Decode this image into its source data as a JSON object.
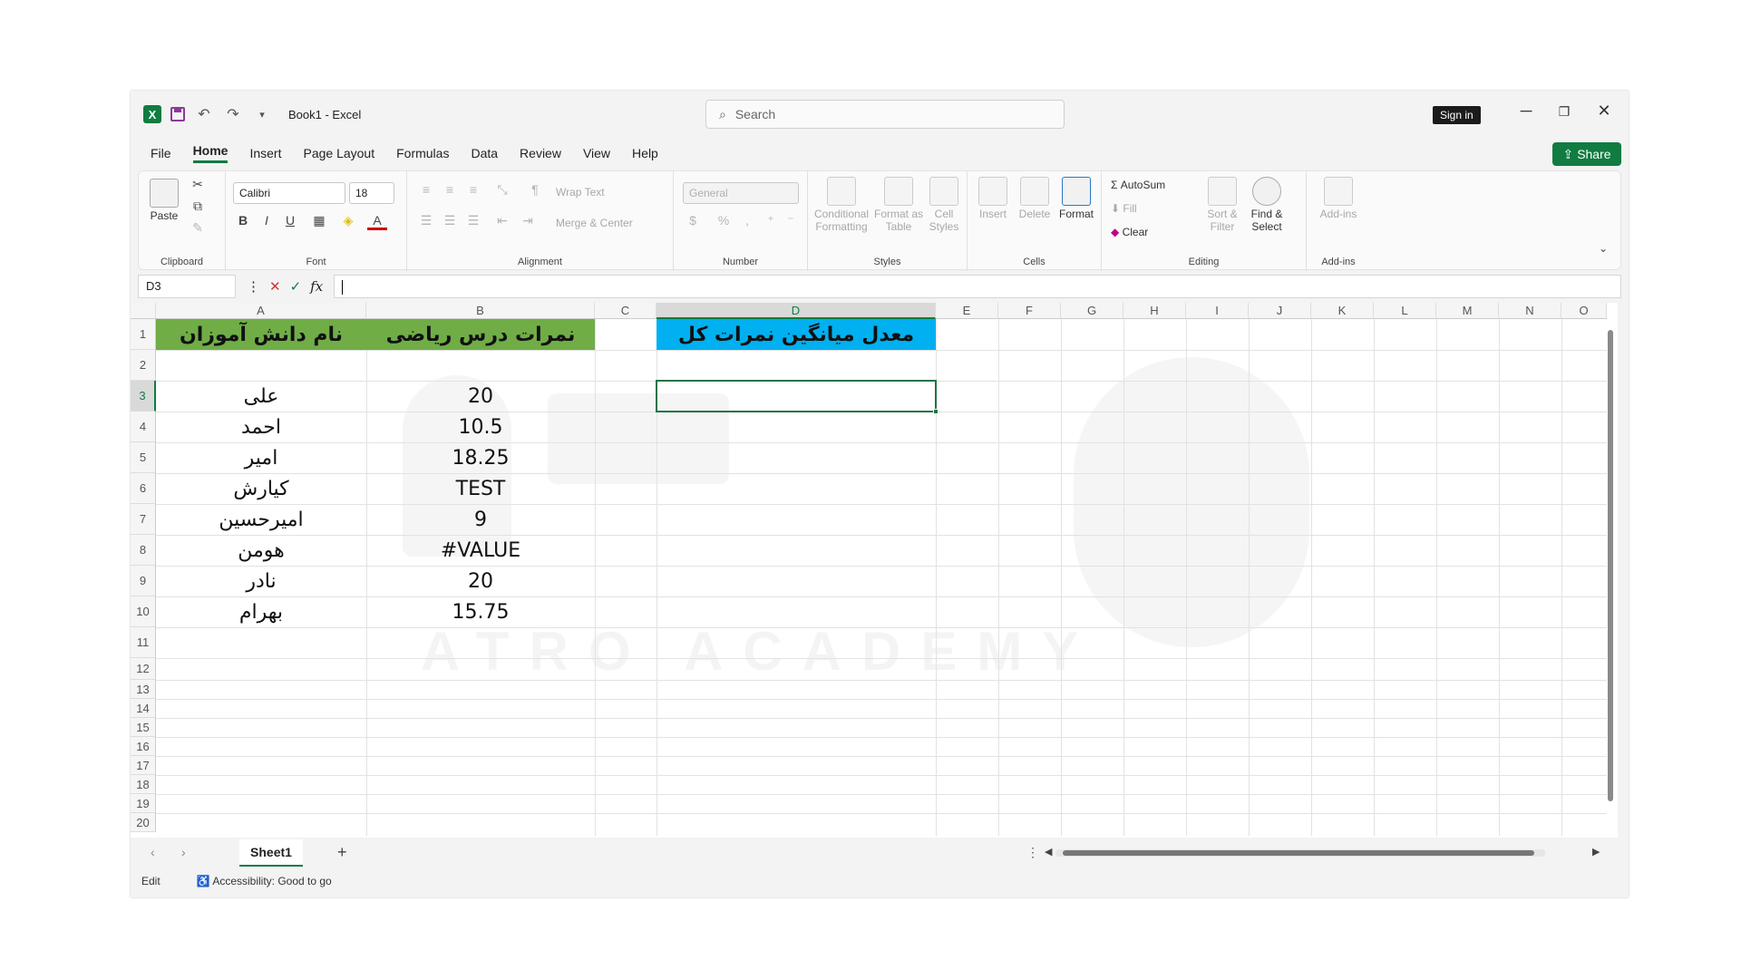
{
  "title_bar": {
    "doc_title": "Book1  -  Excel",
    "search_placeholder": "Search",
    "sign_in": "Sign in",
    "icons": [
      "excel-logo-icon",
      "save-icon",
      "undo-icon",
      "redo-icon",
      "customize-icon"
    ]
  },
  "menu": {
    "tabs": [
      "File",
      "Home",
      "Insert",
      "Page Layout",
      "Formulas",
      "Data",
      "Review",
      "View",
      "Help"
    ],
    "active": "Home",
    "share_label": "Share"
  },
  "ribbon": {
    "clipboard": {
      "label": "Clipboard",
      "paste": "Paste"
    },
    "font": {
      "label": "Font",
      "font_name": "Calibri",
      "font_size": "18"
    },
    "alignment": {
      "label": "Alignment",
      "wrap_text": "Wrap Text",
      "merge_center": "Merge & Center"
    },
    "number": {
      "label": "Number",
      "format": "General"
    },
    "styles": {
      "label": "Styles",
      "conditional": "Conditional",
      "conditional2": "Formatting",
      "format_as": "Format as",
      "format_as2": "Table",
      "cell": "Cell",
      "cell2": "Styles"
    },
    "cells": {
      "label": "Cells",
      "insert": "Insert",
      "delete": "Delete",
      "format": "Format"
    },
    "editing": {
      "label": "Editing",
      "autosum": "AutoSum",
      "fill": "Fill",
      "clear": "Clear",
      "sort": "Sort &",
      "sort2": "Filter",
      "find": "Find &",
      "find2": "Select"
    },
    "addins": {
      "label": "Add-ins",
      "addins": "Add-ins"
    }
  },
  "formula_bar": {
    "name_box": "D3",
    "fx": "fx",
    "value": ""
  },
  "grid": {
    "columns": [
      "A",
      "B",
      "C",
      "D",
      "E",
      "F",
      "G",
      "H",
      "I",
      "J",
      "K",
      "L",
      "M",
      "N",
      "O"
    ],
    "selected_column": "D",
    "rows": [
      "1",
      "2",
      "3",
      "4",
      "5",
      "6",
      "7",
      "8",
      "9",
      "10",
      "11",
      "12",
      "13",
      "14",
      "15",
      "16",
      "17",
      "18",
      "19",
      "20"
    ],
    "selected_row": "3",
    "header_a": "نام دانش آموزان",
    "header_b": "نمرات درس ریاضی",
    "header_d": "معدل میانگین نمرات کل",
    "students": [
      "علی",
      "احمد",
      "امیر",
      "کیارش",
      "امیرحسین",
      "هومن",
      "نادر",
      "بهرام"
    ],
    "scores": [
      "20",
      "10.5",
      "18.25",
      "TEST",
      "9",
      "#VALUE",
      "20",
      "15.75"
    ],
    "watermark_text": "ATRO ACADEMY"
  },
  "sheets": {
    "tabs": [
      "Sheet1"
    ],
    "active": "Sheet1",
    "add": "+"
  },
  "status": {
    "mode": "Edit",
    "accessibility": "Accessibility: Good to go"
  },
  "colors": {
    "excel_green": "#107c41",
    "header_green": "#70ad47",
    "header_blue": "#00b0f0"
  }
}
